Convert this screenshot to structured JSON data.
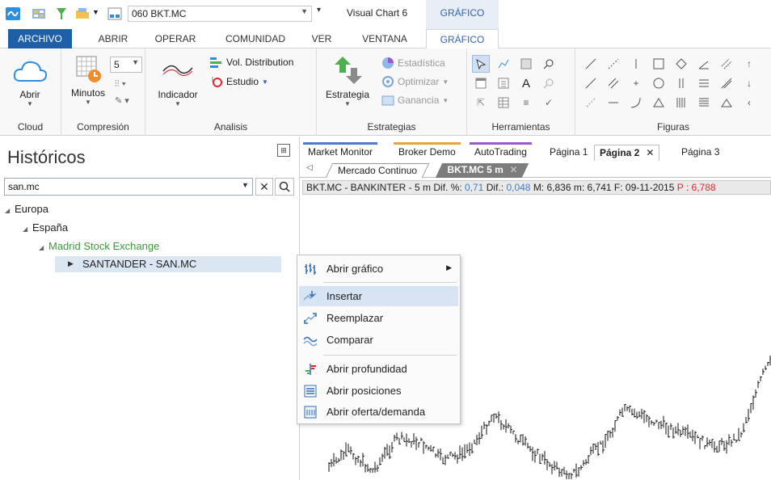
{
  "titlebar": {
    "symbol_value": "060 BKT.MC",
    "app_title": "Visual Chart 6",
    "context_tab": "GRÁFICO"
  },
  "ribbon_tabs": [
    "ARCHIVO",
    "ABRIR",
    "OPERAR",
    "COMUNIDAD",
    "VER",
    "VENTANA",
    "GRÁFICO"
  ],
  "ribbon": {
    "cloud": {
      "open_label": "Abrir",
      "group": "Cloud"
    },
    "compresion": {
      "minutes_label": "Minutos",
      "period_value": "5",
      "group": "Compresión"
    },
    "analisis": {
      "indicator_label": "Indicador",
      "vol_label": "Vol. Distribution",
      "study_label": "Estudio",
      "group": "Analisis"
    },
    "estrategias": {
      "strategy_label": "Estrategia",
      "stats_label": "Estadística",
      "optimize_label": "Optimizar",
      "profit_label": "Ganancia",
      "group": "Estrategias"
    },
    "herramientas": {
      "group": "Herramientas"
    },
    "figuras": {
      "group": "Figuras"
    }
  },
  "left_panel": {
    "title": "Históricos",
    "search_value": "san.mc",
    "tree": {
      "region": "Europa",
      "country": "España",
      "exchange": "Madrid Stock Exchange",
      "instrument": "SANTANDER - SAN.MC"
    }
  },
  "window_tabs": [
    {
      "label": "Market Monitor",
      "color": "#4a7cc7"
    },
    {
      "label": "Broker Demo",
      "color": "#e8a33b"
    },
    {
      "label": "AutoTrading",
      "color": "#9b59d0"
    },
    {
      "label": "Página 1",
      "color": ""
    },
    {
      "label": "Página 2",
      "color": ""
    },
    {
      "label": "Página 3",
      "color": ""
    }
  ],
  "sub_tabs": {
    "first": "Mercado Continuo",
    "second": "BKT.MC 5 m"
  },
  "info_bar": {
    "name": "BKT.MC - BANKINTER - 5 m",
    "dif_pct_label": "Dif. %:",
    "dif_pct": "0,71",
    "dif_label": "Dif.:",
    "dif": "0,048",
    "max": "M: 6,836",
    "min": "m: 6,741",
    "date": "F: 09-11-2015",
    "price": "P : 6,788"
  },
  "context_menu": {
    "items": [
      {
        "label": "Abrir gráfico",
        "icon": "bars-chart-icon",
        "submenu": true
      },
      {
        "label": "Insertar",
        "icon": "insert-icon",
        "highlighted": true
      },
      {
        "label": "Reemplazar",
        "icon": "replace-icon"
      },
      {
        "label": "Comparar",
        "icon": "compare-icon"
      },
      {
        "label": "Abrir profundidad",
        "icon": "depth-icon"
      },
      {
        "label": "Abrir posiciones",
        "icon": "positions-icon"
      },
      {
        "label": "Abrir oferta/demanda",
        "icon": "bid-ask-icon"
      }
    ]
  }
}
